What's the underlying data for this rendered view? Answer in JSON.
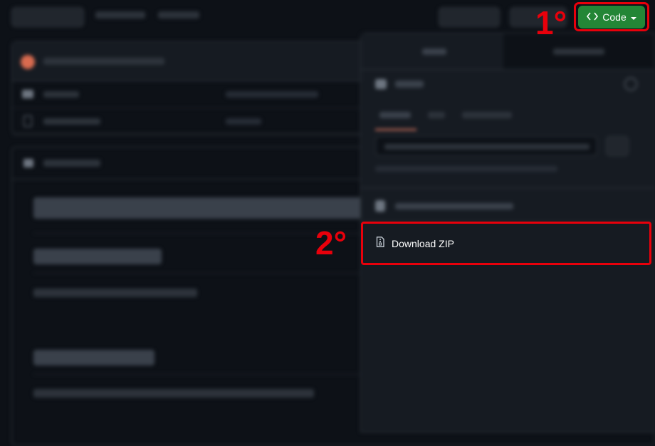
{
  "code_button": {
    "label": "Code"
  },
  "annotations": {
    "step1": "1°",
    "step2": "2°"
  },
  "dropdown": {
    "download_zip_label": "Download ZIP"
  },
  "colors": {
    "background": "#0d1117",
    "code_button": "#238636",
    "annotation_red": "#e8000b"
  },
  "icons": [
    "code-brackets-icon",
    "caret-down-icon",
    "zip-file-icon"
  ]
}
